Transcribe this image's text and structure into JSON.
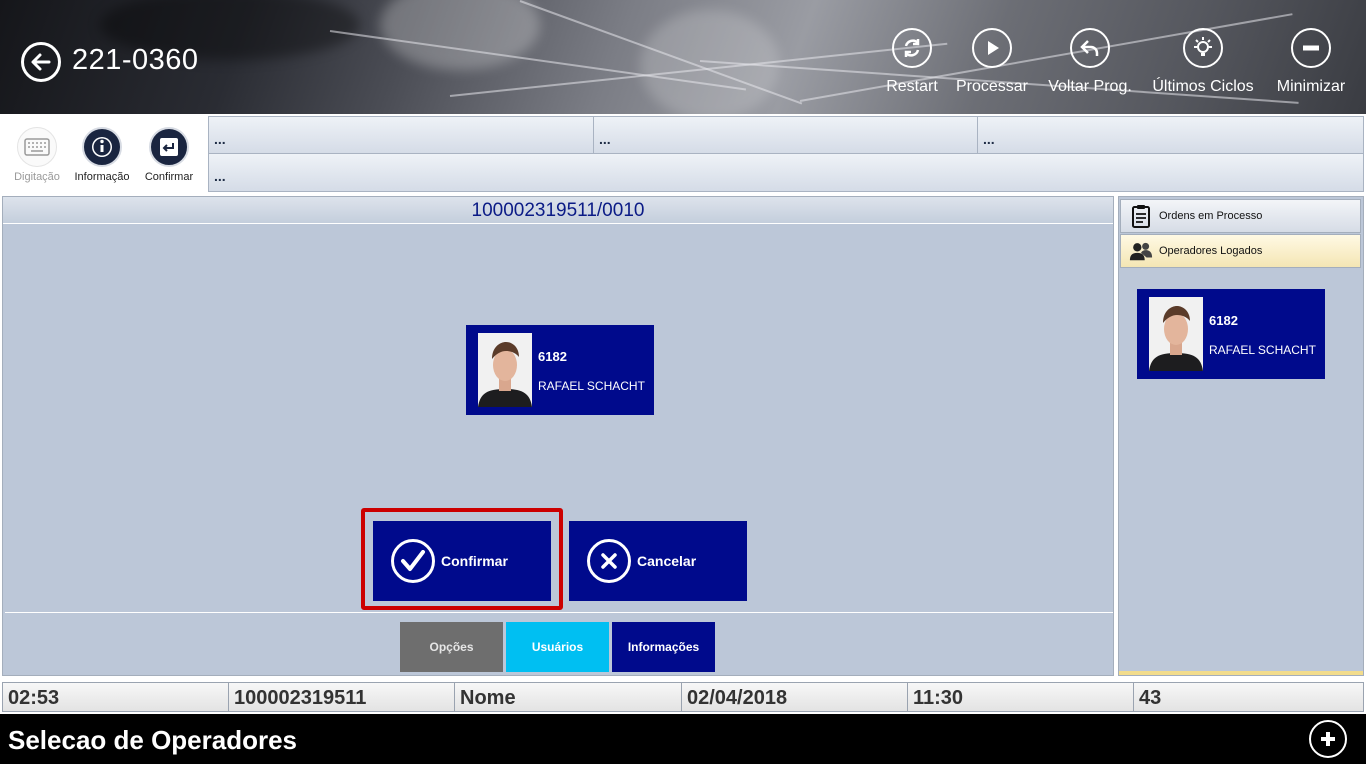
{
  "header": {
    "title": "221-0360",
    "buttons": [
      {
        "label": "Restart",
        "icon": "restart-icon"
      },
      {
        "label": "Processar",
        "icon": "play-icon"
      },
      {
        "label": "Voltar Prog.",
        "icon": "undo-icon"
      },
      {
        "label": "Últimos Ciclos",
        "icon": "lightbulb-icon"
      },
      {
        "label": "Minimizar",
        "icon": "minus-icon"
      }
    ]
  },
  "toolbar": {
    "items": [
      {
        "label": "Digitação",
        "icon": "keyboard-icon",
        "enabled": false
      },
      {
        "label": "Informação",
        "icon": "info-icon",
        "enabled": true
      },
      {
        "label": "Confirmar",
        "icon": "enter-icon",
        "enabled": true
      }
    ]
  },
  "info_grid": {
    "cells": [
      "...",
      "...",
      "...",
      "..."
    ]
  },
  "main": {
    "order": "100002319511/0010",
    "operator": {
      "code": "6182",
      "name": "RAFAEL SCHACHT"
    },
    "confirm_label": "Confirmar",
    "cancel_label": "Cancelar",
    "tabs": [
      {
        "label": "Opções",
        "color": "#6e6e6e"
      },
      {
        "label": "Usuários",
        "color": "#00bff2"
      },
      {
        "label": "Informações",
        "color": "#000a8c"
      }
    ]
  },
  "side": {
    "tabs": [
      {
        "label": "Ordens em Processo",
        "icon": "clipboard-icon"
      },
      {
        "label": "Operadores Logados",
        "icon": "users-icon"
      }
    ],
    "operator": {
      "code": "6182",
      "name": "RAFAEL SCHACHT"
    }
  },
  "status_bar": {
    "cells": [
      "02:53",
      "100002319511",
      "Nome",
      "02/04/2018",
      "11:30",
      "43"
    ]
  },
  "footer": {
    "title": "Selecao de Operadores",
    "add_icon": "plus-icon"
  },
  "colors": {
    "primary_blue": "#000a8c",
    "panel_bg": "#bcc7d8",
    "highlight_red": "#cc0000"
  }
}
